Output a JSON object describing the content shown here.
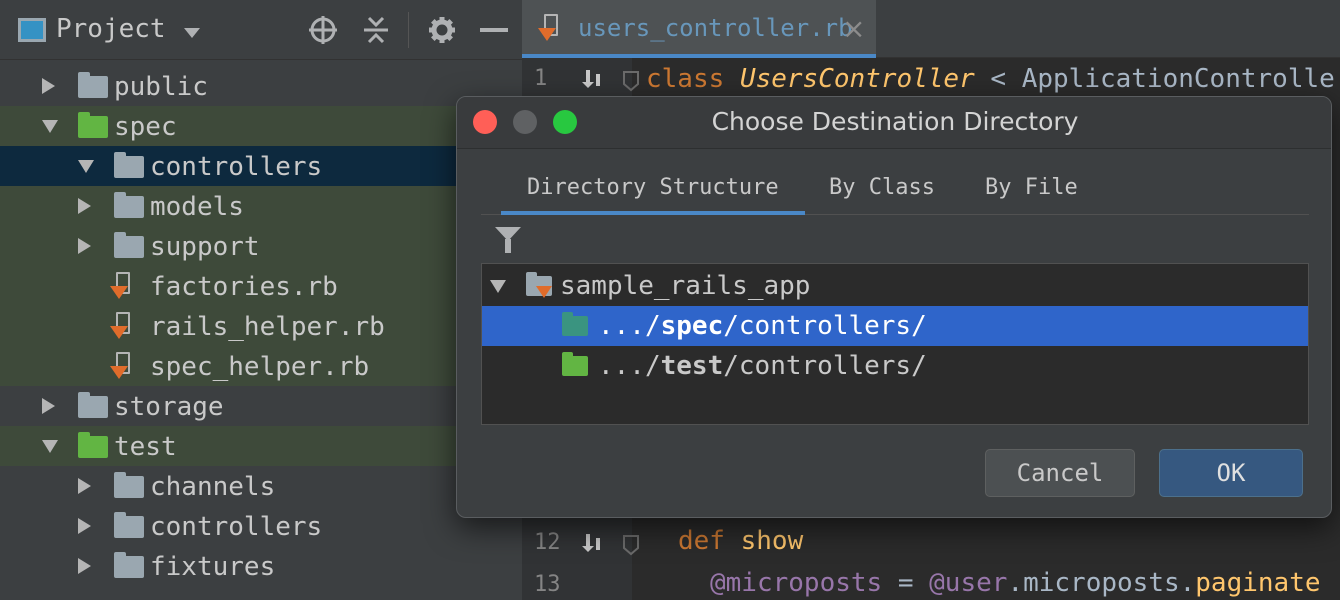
{
  "project_panel": {
    "title": "Project",
    "tree": [
      {
        "label": "public",
        "state": "collapsed",
        "kind": "folder",
        "color": "gray"
      },
      {
        "label": "spec",
        "state": "expanded",
        "kind": "folder",
        "color": "green"
      },
      {
        "label": "controllers",
        "state": "expanded",
        "kind": "folder",
        "color": "gray"
      },
      {
        "label": "models",
        "state": "collapsed",
        "kind": "folder",
        "color": "gray"
      },
      {
        "label": "support",
        "state": "collapsed",
        "kind": "folder",
        "color": "gray"
      },
      {
        "label": "factories.rb",
        "kind": "ruby-file"
      },
      {
        "label": "rails_helper.rb",
        "kind": "ruby-file"
      },
      {
        "label": "spec_helper.rb",
        "kind": "ruby-file"
      },
      {
        "label": "storage",
        "state": "collapsed",
        "kind": "folder",
        "color": "gray"
      },
      {
        "label": "test",
        "state": "expanded",
        "kind": "folder",
        "color": "green"
      },
      {
        "label": "channels",
        "state": "collapsed",
        "kind": "folder",
        "color": "gray"
      },
      {
        "label": "controllers",
        "state": "collapsed",
        "kind": "folder",
        "color": "gray"
      },
      {
        "label": "fixtures",
        "state": "collapsed",
        "kind": "folder",
        "color": "gray"
      }
    ]
  },
  "editor": {
    "tab_label": "users_controller.rb",
    "lines": {
      "l1": {
        "num": "1",
        "kw": "class",
        "cls": "UsersController",
        "rest": " < ApplicationControlle"
      },
      "l12": {
        "num": "12",
        "kw": "def",
        "fn": "show"
      },
      "l13": {
        "num": "13",
        "ivar": "@microposts",
        "mid": " = ",
        "ivar2": "@user",
        "rest": ".microposts.",
        "fn": "paginate"
      }
    }
  },
  "dialog": {
    "title": "Choose Destination Directory",
    "tabs": {
      "directory_structure": "Directory Structure",
      "by_class": "By Class",
      "by_file": "By File"
    },
    "tree": {
      "root": "sample_rails_app",
      "spec_prefix": ".../",
      "spec_bold": "spec",
      "spec_suffix": "/controllers/",
      "test_prefix": ".../",
      "test_bold": "test",
      "test_suffix": "/controllers/"
    },
    "cancel_label": "Cancel",
    "ok_label": "OK"
  },
  "colors": {
    "selection": "#2f65ca",
    "tree_selection": "#0d293e",
    "accent": "#4a88c7"
  }
}
